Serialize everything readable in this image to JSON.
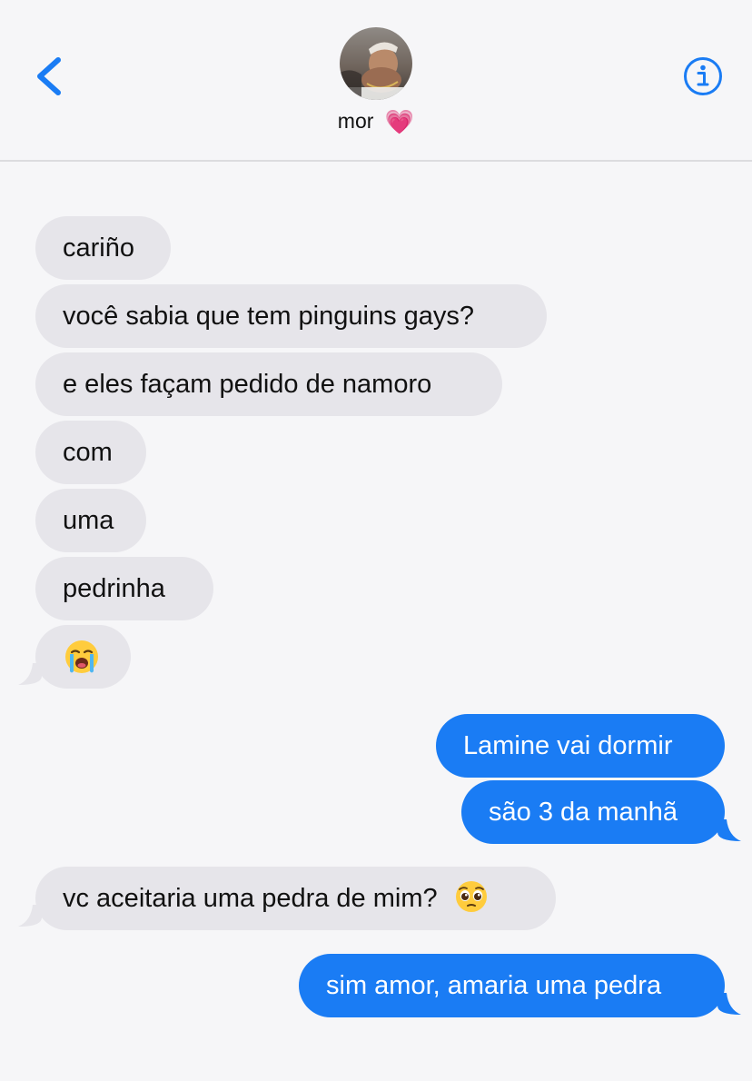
{
  "header": {
    "contact_name": "mor",
    "contact_emoji": "💗",
    "back_icon": "chevron-left-icon",
    "info_icon": "info-icon",
    "accent_color": "#1a7cf4"
  },
  "messages": [
    {
      "direction": "received",
      "text": "cariño"
    },
    {
      "direction": "received",
      "text": "você sabia que tem pinguins gays?"
    },
    {
      "direction": "received",
      "text": "e eles façam pedido de namoro"
    },
    {
      "direction": "received",
      "text": "com"
    },
    {
      "direction": "received",
      "text": "uma"
    },
    {
      "direction": "received",
      "text": "pedrinha"
    },
    {
      "direction": "received",
      "text": "",
      "emoji": "loudly-crying-face"
    },
    {
      "direction": "sent",
      "text": "Lamine vai dormir"
    },
    {
      "direction": "sent",
      "text": "são 3 da manhã"
    },
    {
      "direction": "received",
      "text": "vc aceitaria uma pedra de mim?",
      "emoji": "pleading-face"
    },
    {
      "direction": "sent",
      "text": "sim amor, amaria uma pedra"
    }
  ],
  "colors": {
    "sent_bubble": "#1a7cf4",
    "received_bubble": "#e6e5ea",
    "background": "#f6f6f8"
  }
}
